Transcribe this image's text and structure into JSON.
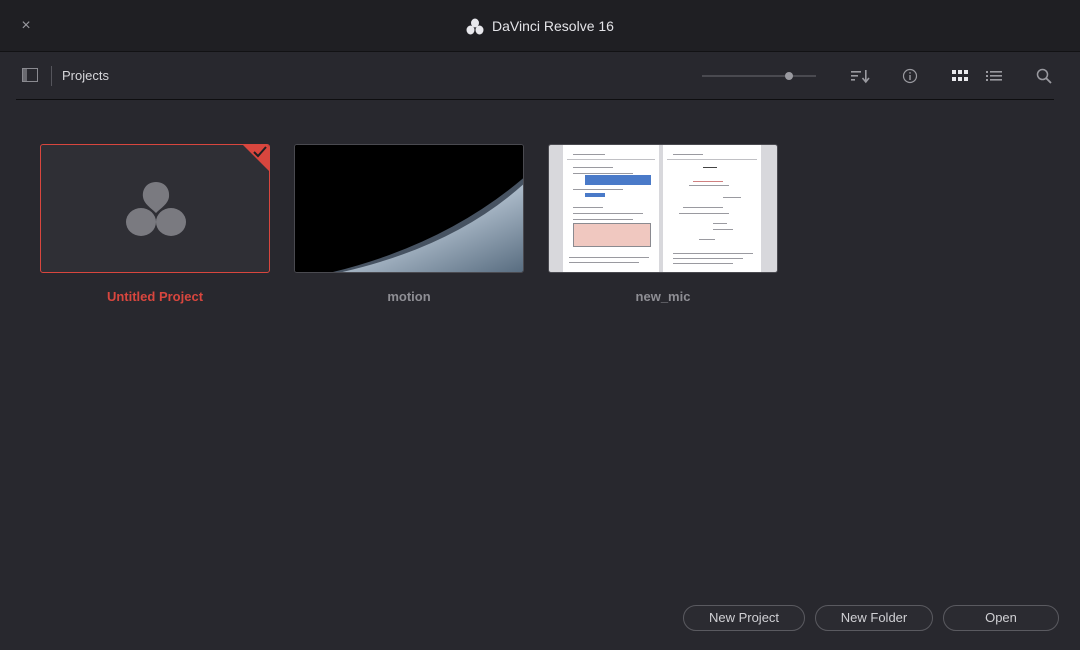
{
  "window": {
    "title": "DaVinci Resolve 16",
    "close_label": "×"
  },
  "toolbar": {
    "breadcrumb": "Projects",
    "zoom_level": 0.78
  },
  "projects": [
    {
      "name": "Untitled Project",
      "selected": true
    },
    {
      "name": "motion",
      "selected": false
    },
    {
      "name": "new_mic",
      "selected": false
    }
  ],
  "buttons": {
    "new_project": "New Project",
    "new_folder": "New Folder",
    "open": "Open"
  },
  "colors": {
    "accent": "#d8463e",
    "background": "#28282e",
    "titlebar": "#1f1f23"
  },
  "icons": [
    "close-icon",
    "resolve-logo-icon",
    "panel-toggle-icon",
    "sort-icon",
    "info-icon",
    "grid-view-icon",
    "list-view-icon",
    "search-icon"
  ]
}
